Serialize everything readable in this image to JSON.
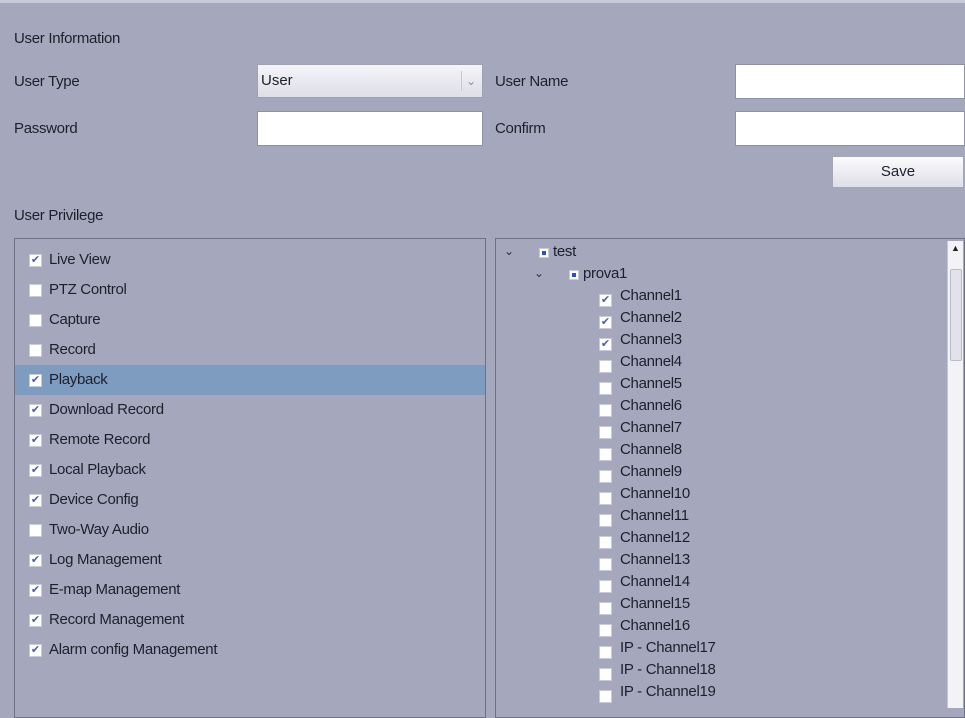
{
  "user_info": {
    "section_title": "User Information",
    "user_type_label": "User Type",
    "user_type_value": "User",
    "user_name_label": "User Name",
    "user_name_value": "",
    "password_label": "Password",
    "password_value": "",
    "confirm_label": "Confirm",
    "confirm_value": "",
    "save_label": "Save"
  },
  "privilege": {
    "section_title": "User Privilege",
    "items": [
      {
        "label": "Live View",
        "checked": true,
        "selected": false
      },
      {
        "label": "PTZ Control",
        "checked": false,
        "selected": false
      },
      {
        "label": "Capture",
        "checked": false,
        "selected": false
      },
      {
        "label": "Record",
        "checked": false,
        "selected": false
      },
      {
        "label": "Playback",
        "checked": true,
        "selected": true
      },
      {
        "label": "Download Record",
        "checked": true,
        "selected": false
      },
      {
        "label": "Remote Record",
        "checked": true,
        "selected": false
      },
      {
        "label": "Local Playback",
        "checked": true,
        "selected": false
      },
      {
        "label": "Device Config",
        "checked": true,
        "selected": false
      },
      {
        "label": "Two-Way Audio",
        "checked": false,
        "selected": false
      },
      {
        "label": "Log Management",
        "checked": true,
        "selected": false
      },
      {
        "label": "E-map Management",
        "checked": true,
        "selected": false
      },
      {
        "label": "Record Management",
        "checked": true,
        "selected": false
      },
      {
        "label": "Alarm config Management",
        "checked": true,
        "selected": false
      }
    ]
  },
  "tree": {
    "root": {
      "label": "test",
      "expanded": true
    },
    "group": {
      "label": "prova1",
      "expanded": true
    },
    "channels": [
      {
        "label": "Channel1",
        "checked": true
      },
      {
        "label": "Channel2",
        "checked": true
      },
      {
        "label": "Channel3",
        "checked": true
      },
      {
        "label": "Channel4",
        "checked": false
      },
      {
        "label": "Channel5",
        "checked": false
      },
      {
        "label": "Channel6",
        "checked": false
      },
      {
        "label": "Channel7",
        "checked": false
      },
      {
        "label": "Channel8",
        "checked": false
      },
      {
        "label": "Channel9",
        "checked": false
      },
      {
        "label": "Channel10",
        "checked": false
      },
      {
        "label": "Channel11",
        "checked": false
      },
      {
        "label": "Channel12",
        "checked": false
      },
      {
        "label": "Channel13",
        "checked": false
      },
      {
        "label": "Channel14",
        "checked": false
      },
      {
        "label": "Channel15",
        "checked": false
      },
      {
        "label": "Channel16",
        "checked": false
      },
      {
        "label": "IP - Channel17",
        "checked": false
      },
      {
        "label": "IP - Channel18",
        "checked": false
      },
      {
        "label": "IP - Channel19",
        "checked": false
      }
    ]
  },
  "icons": {
    "check": "✔",
    "chevron_down": "⌄",
    "scroll_up": "▲",
    "select_arrow": "⌄"
  },
  "colors": {
    "background": "#a5a8bd",
    "selected_row": "#7e9cbf",
    "node_icon": "#2a4fc9"
  }
}
